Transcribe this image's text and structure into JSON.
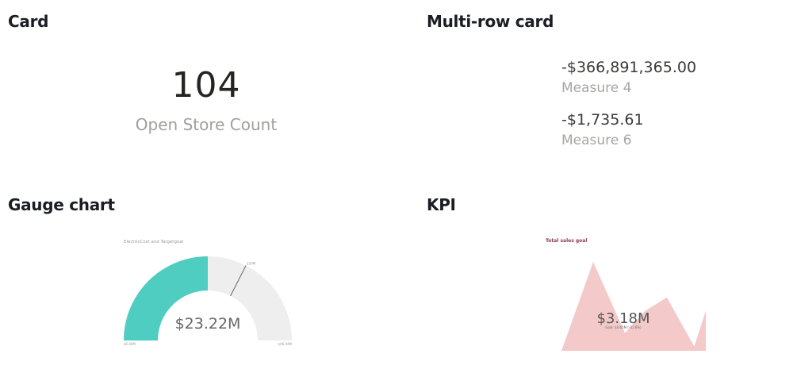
{
  "sections": {
    "card": "Card",
    "multirow": "Multi-row card",
    "gauge": "Gauge chart",
    "kpi": "KPI"
  },
  "card": {
    "value": "104",
    "label": "Open Store Count"
  },
  "multirow_card": {
    "rows": [
      {
        "value": "-$366,891,365.00",
        "label": "Measure 4"
      },
      {
        "value": "-$1,735.61",
        "label": "Measure 6"
      }
    ]
  },
  "gauge": {
    "title": "ElectricCost and Targetgoal",
    "value_label": "$23.22M",
    "min_label": "$0.00M",
    "max_label": "$46.44M",
    "target_label": "$30M",
    "fill_fraction": 0.5,
    "target_fraction": 0.65,
    "colors": {
      "fill": "#4ecdc0",
      "track": "#eeeeee",
      "target": "#666666"
    }
  },
  "kpi": {
    "title": "Total sales goal",
    "value_label": "$3.18M",
    "goal_label": "Goal: $4.65M (-31.6%)",
    "trend": [
      0,
      1.0,
      0.2,
      0.45,
      0.6,
      0.05,
      0.45
    ],
    "colors": {
      "area": "#f4c9c9",
      "title": "#8b3a52"
    }
  },
  "chart_data": [
    {
      "type": "gauge",
      "title": "ElectricCost and Targetgoal",
      "value": 23.22,
      "min": 0,
      "max": 46.44,
      "target": 30,
      "value_label": "$23.22M"
    },
    {
      "type": "area",
      "title": "Total sales goal",
      "x": [
        1,
        2,
        3,
        4,
        5,
        6,
        7
      ],
      "values": [
        0,
        1.0,
        0.2,
        0.45,
        0.6,
        0.05,
        0.45
      ],
      "value_label": "$3.18M",
      "goal_label": "Goal: $4.65M (-31.6%)"
    }
  ]
}
